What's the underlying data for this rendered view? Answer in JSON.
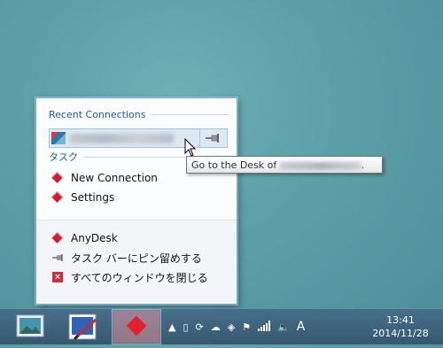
{
  "jumplist": {
    "recent_header": "Recent Connections",
    "tasks_header": "タスク",
    "tasks": [
      {
        "label": "New Connection"
      },
      {
        "label": "Settings"
      }
    ],
    "app_name": "AnyDesk",
    "pin_taskbar": "タスク バーにピン留めする",
    "close_all": "すべてのウィンドウを閉じる"
  },
  "tooltip": {
    "prefix": "Go to the Desk of",
    "suffix": "."
  },
  "taskbar": {
    "tray_ime": "A",
    "time": "13:41",
    "date": "2014/11/28"
  },
  "colors": {
    "accent": "#1c5aa6",
    "anydesk_red": "#d51a2c",
    "taskbar": "#3f6682"
  }
}
